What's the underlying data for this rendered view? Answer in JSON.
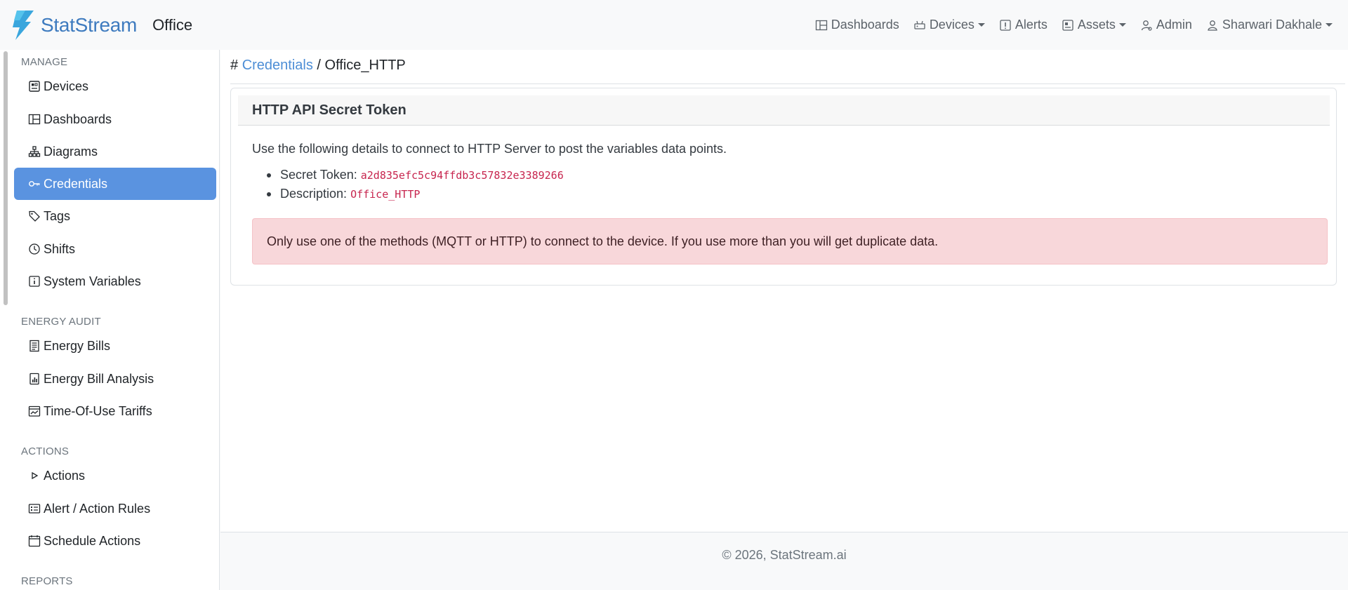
{
  "navbar": {
    "brand": "StatStream",
    "site": "Office",
    "items": [
      {
        "label": "Dashboards",
        "icon": "dashboard-icon",
        "dropdown": false
      },
      {
        "label": "Devices",
        "icon": "devices-icon",
        "dropdown": true
      },
      {
        "label": "Alerts",
        "icon": "alert-icon",
        "dropdown": false
      },
      {
        "label": "Assets",
        "icon": "assets-icon",
        "dropdown": true
      },
      {
        "label": "Admin",
        "icon": "admin-icon",
        "dropdown": false
      },
      {
        "label": "Sharwari Dakhale",
        "icon": "user-icon",
        "dropdown": true
      }
    ]
  },
  "sidebar": {
    "sections": [
      {
        "title": "MANAGE"
      },
      {
        "title": "ENERGY AUDIT"
      },
      {
        "title": "ACTIONS"
      },
      {
        "title": "REPORTS"
      }
    ],
    "items": [
      {
        "label": "Devices",
        "icon": "devices-icon"
      },
      {
        "label": "Dashboards",
        "icon": "dashboard-icon"
      },
      {
        "label": "Diagrams",
        "icon": "diagram-icon"
      },
      {
        "label": "Credentials",
        "icon": "key-icon",
        "active": true
      },
      {
        "label": "Tags",
        "icon": "tag-icon"
      },
      {
        "label": "Shifts",
        "icon": "clock-icon"
      },
      {
        "label": "System Variables",
        "icon": "info-icon"
      },
      {
        "label": "Energy Bills",
        "icon": "receipt-icon"
      },
      {
        "label": "Energy Bill Analysis",
        "icon": "chart-icon"
      },
      {
        "label": "Time-Of-Use Tariffs",
        "icon": "calendar-chart-icon"
      },
      {
        "label": "Actions",
        "icon": "play-icon"
      },
      {
        "label": "Alert / Action Rules",
        "icon": "rules-icon"
      },
      {
        "label": "Schedule Actions",
        "icon": "calendar-icon"
      }
    ]
  },
  "breadcrumb": {
    "hash": "#",
    "link": "Credentials",
    "separator": "/",
    "current": "Office_HTTP"
  },
  "card": {
    "title": "HTTP API Secret Token",
    "intro": "Use the following details to connect to HTTP Server to post the variables data points.",
    "token_label": "Secret Token:",
    "token_value": "a2d835efc5c94ffdb3c57832e3389266",
    "desc_label": "Description:",
    "desc_value": "Office_HTTP",
    "warning": "Only use one of the methods (MQTT or HTTP) to connect to the device. If you use more than you will get duplicate data."
  },
  "footer": {
    "text": "© 2026, StatStream.ai"
  },
  "colors": {
    "accent": "#5a93e0",
    "link": "#4d8ed6",
    "code": "#c7254e",
    "alert_bg": "#f8d7da"
  }
}
